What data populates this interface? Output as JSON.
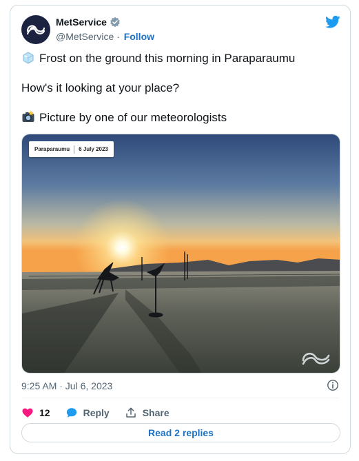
{
  "user": {
    "display_name": "MetService",
    "handle": "@MetService",
    "separator": " · ",
    "follow_label": "Follow"
  },
  "tweet": {
    "lines": [
      "Frost on the ground this morning in Paraparaumu",
      "How's it looking at your place?",
      "Picture by one of our meteorologists"
    ]
  },
  "photo": {
    "location": "Paraparaumu",
    "date": "6 July 2023"
  },
  "meta": {
    "timestamp": "9:25 AM · Jul 6, 2023"
  },
  "actions": {
    "like_count": "12",
    "reply_label": "Reply",
    "share_label": "Share"
  },
  "read_replies_label": "Read 2 replies",
  "colors": {
    "brand": "#1d9bf0",
    "link": "#1d72c4",
    "like": "#f91880",
    "avatar_bg": "#1b2341"
  },
  "icons": [
    "metservice-logo-icon",
    "verified-badge-icon",
    "twitter-bird-icon",
    "ice-cube-emoji-icon",
    "camera-flash-emoji-icon",
    "info-icon",
    "heart-icon",
    "reply-bubble-icon",
    "share-icon"
  ]
}
